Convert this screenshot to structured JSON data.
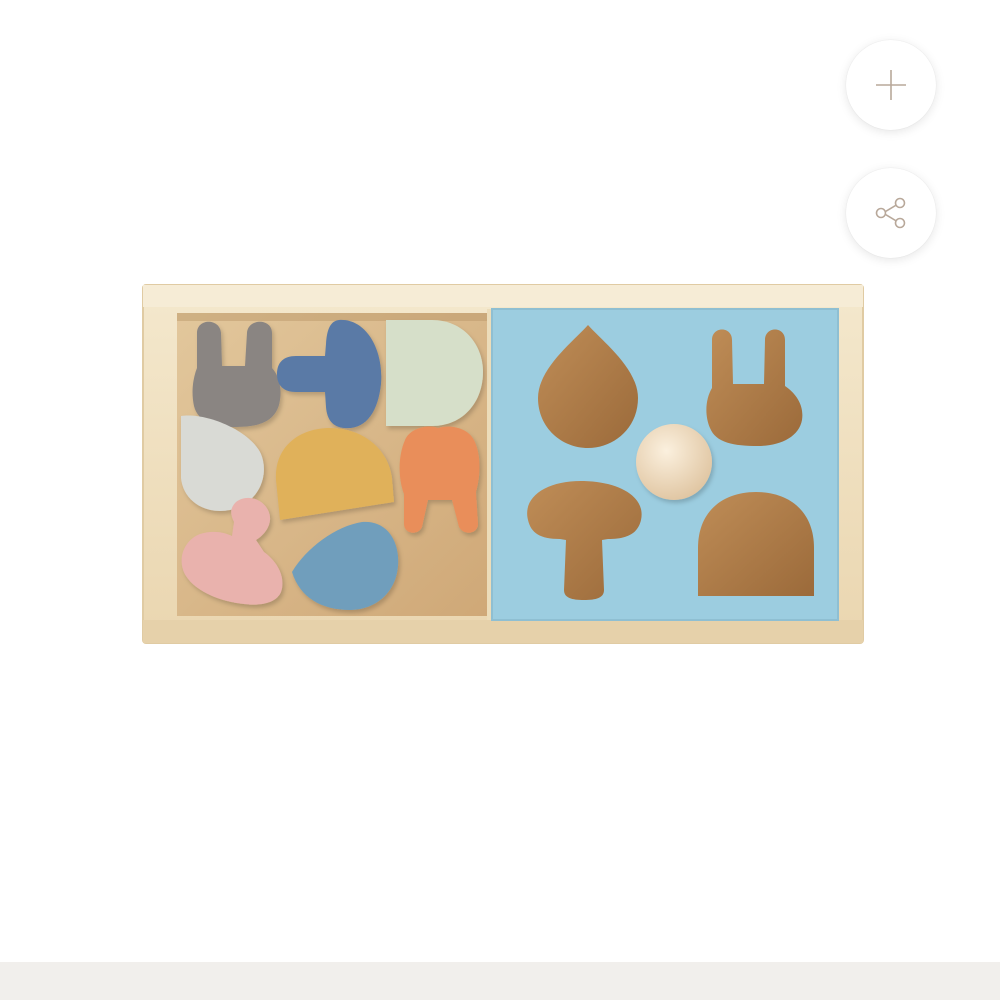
{
  "product": {
    "image_name": "wooden-shape-sorter-box",
    "piece_colors": [
      "#8a8582",
      "#5a7aa6",
      "#d6dfc9",
      "#d9dad5",
      "#e0b15a",
      "#e98e5a",
      "#e9b2ad",
      "#6f9ebc"
    ],
    "board_color": "#9ccde0",
    "frame_color": "#f1e3c4",
    "tray_color": "#dbbc8d",
    "cutout_color": "#b07c48",
    "knob_color": "#f3e2c8"
  },
  "actions": {
    "zoom_icon": "plus-icon",
    "share_icon": "share-icon",
    "icon_color": "#b8a89a"
  }
}
